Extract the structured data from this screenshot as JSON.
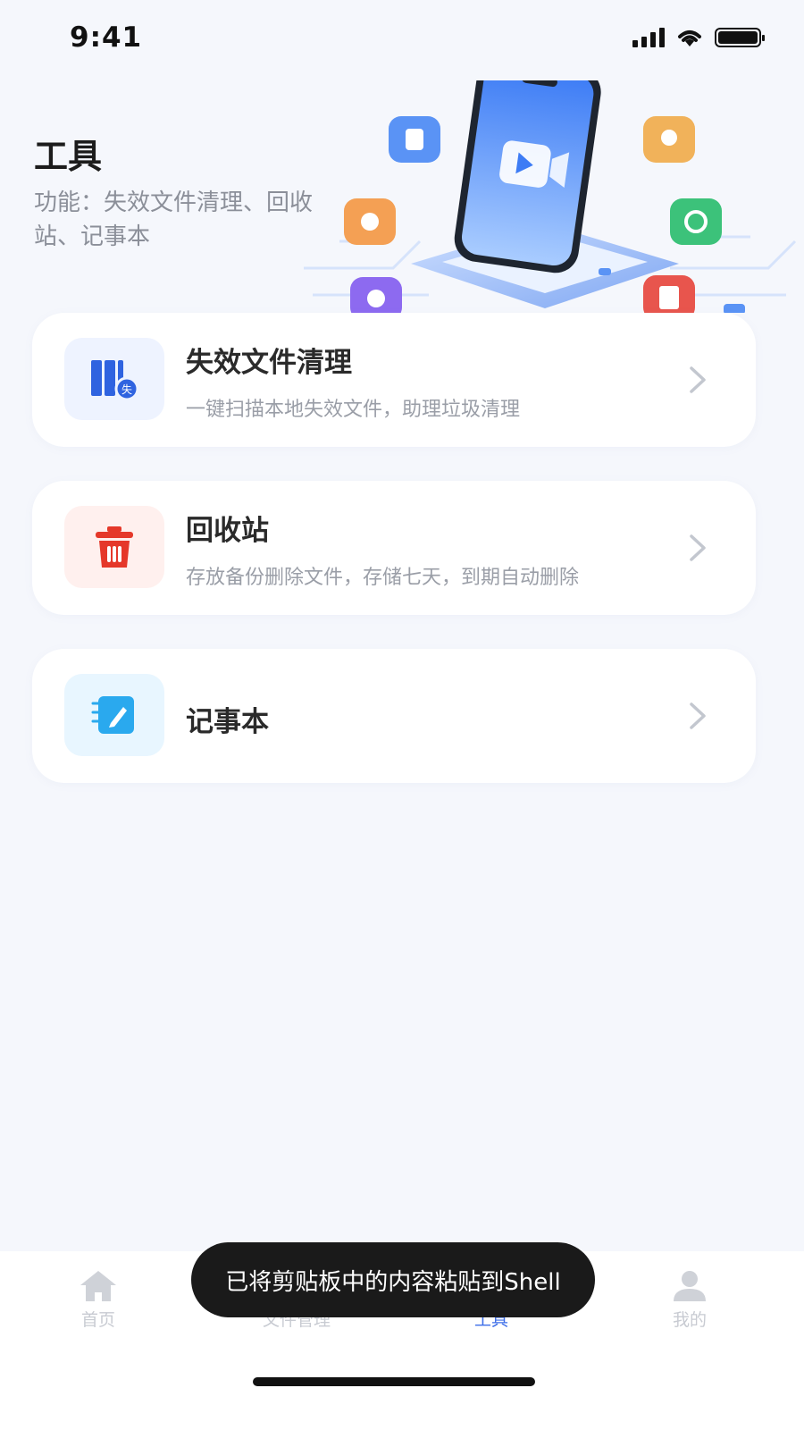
{
  "status_bar": {
    "time": "9:41"
  },
  "header": {
    "title": "工具",
    "description": "功能：失效文件清理、回收站、记事本"
  },
  "tools": [
    {
      "title": "失效文件清理",
      "subtitle": "一键扫描本地失效文件，助理垃圾清理",
      "icon": "file-cleanup-icon"
    },
    {
      "title": "回收站",
      "subtitle": "存放备份删除文件，存储七天，到期自动删除",
      "icon": "trash-icon"
    },
    {
      "title": "记事本",
      "subtitle": "",
      "icon": "notepad-icon"
    }
  ],
  "tab_bar": {
    "tabs": [
      {
        "label": "首页",
        "icon": "home-icon"
      },
      {
        "label": "文件管理",
        "icon": "folder-icon"
      },
      {
        "label": "工具",
        "icon": "tools-icon",
        "active": true
      },
      {
        "label": "我的",
        "icon": "user-icon"
      }
    ]
  },
  "toast": {
    "message": "已将剪贴板中的内容粘贴到Shell"
  },
  "colors": {
    "accent": "#3d6ee8",
    "trash_red": "#e5382a",
    "notepad_blue": "#2aa9ee",
    "background": "#f5f7fc"
  }
}
